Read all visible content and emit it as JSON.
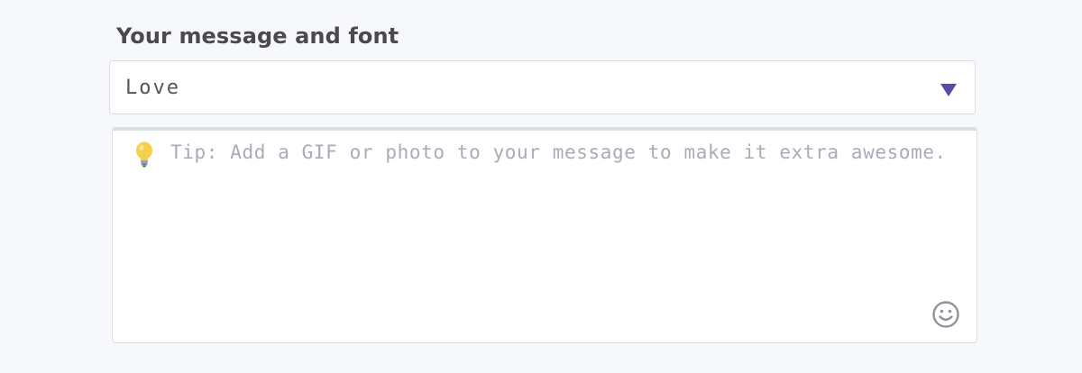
{
  "form": {
    "section_label": "Your message and font",
    "font_select": {
      "selected": "Love"
    },
    "message": {
      "placeholder": "Tip: Add a GIF or photo to your message to make it extra awesome.",
      "value": ""
    }
  },
  "icons": {
    "tip": "lightbulb-icon",
    "emoji": "smiley-icon",
    "dropdown": "caret-down-icon"
  },
  "colors": {
    "accent": "#5b4ba5",
    "background": "#f6f8fc",
    "placeholder": "#a9acb6",
    "bulb": "#f5cf4a"
  }
}
